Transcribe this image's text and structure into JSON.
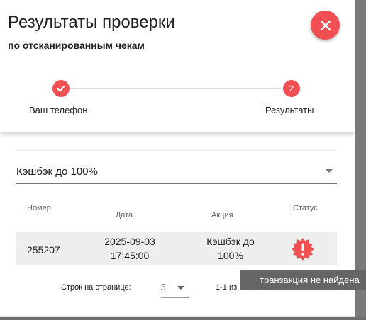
{
  "dialog": {
    "title": "Результаты проверки",
    "subtitle": "по отсканированным чекам"
  },
  "stepper": {
    "steps": [
      {
        "label": "Ваш телефон",
        "state": "completed",
        "icon": "check-icon"
      },
      {
        "label": "Результаты",
        "state": "active",
        "number": "2"
      }
    ]
  },
  "filter": {
    "selected": "Кэшбэк до 100%"
  },
  "table": {
    "headers": {
      "number": "Номер",
      "date": "Дата",
      "promo": "Акция",
      "status": "Статус"
    },
    "rows": [
      {
        "number": "255207",
        "date_line1": "2025-09-03",
        "date_line2": "17:45:00",
        "promo_line1": "Кэшбэк до",
        "promo_line2": "100%",
        "status_icon": "warning-badge-icon"
      }
    ]
  },
  "pagination": {
    "rows_label": "Строк на странице:",
    "rows_value": "5",
    "range": "1-1 из 1"
  },
  "tooltip": {
    "text": "транзакция не найдена"
  },
  "colors": {
    "accent": "#f24f53",
    "row_bg": "#eeeeee",
    "tooltip_bg": "#656565"
  }
}
